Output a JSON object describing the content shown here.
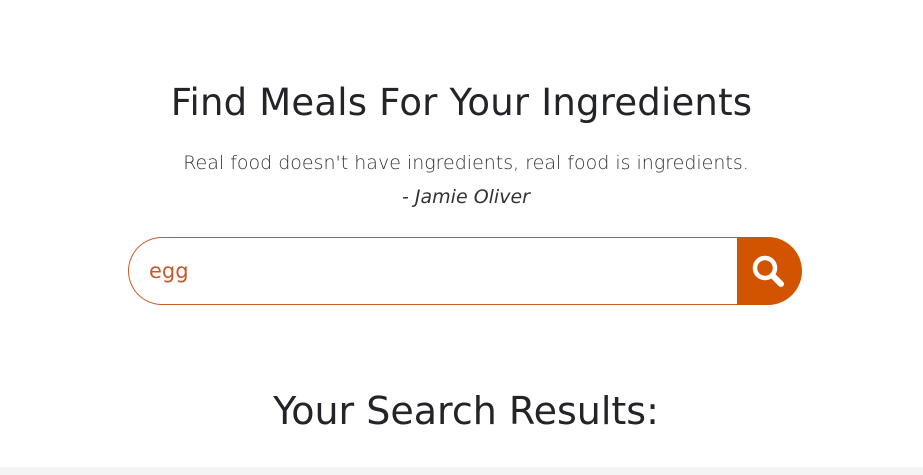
{
  "header": {
    "title": "Find Meals For Your Ingredients",
    "quote": "Real food doesn't have ingredients, real food is ingredients.",
    "author": "- Jamie Oliver"
  },
  "search": {
    "value": "egg",
    "button_icon": "search-icon"
  },
  "results": {
    "title": "Your Search Results:"
  },
  "colors": {
    "accent": "#d35400",
    "input_border": "#c75a2a",
    "text": "#222427"
  }
}
